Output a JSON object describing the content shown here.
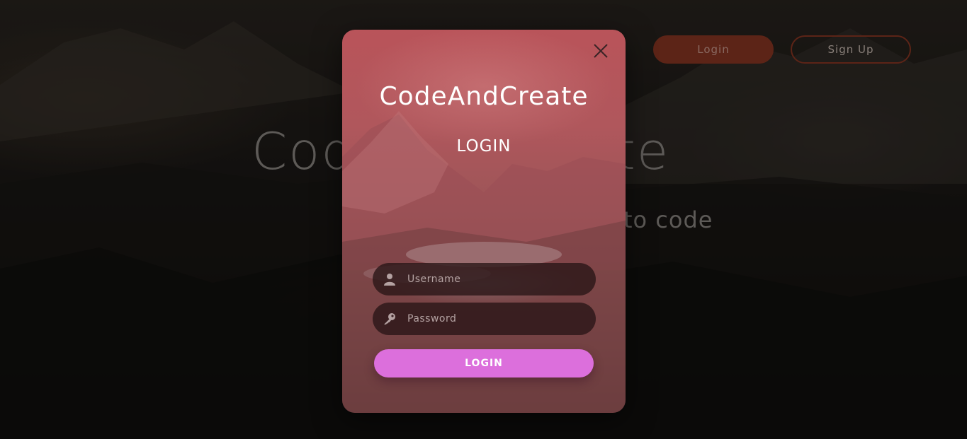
{
  "nav": {
    "login_label": "Login",
    "signup_label": "Sign Up"
  },
  "hero": {
    "title": "CodeAndCreate",
    "subtitle": "to code"
  },
  "modal": {
    "brand": "CodeAndCreate",
    "title": "LOGIN",
    "username_placeholder": "Username",
    "password_placeholder": "Password",
    "submit_label": "LOGIN",
    "close_icon": "close-icon",
    "username_icon": "user-icon",
    "password_icon": "key-icon"
  },
  "colors": {
    "accent": "#dc6fdc",
    "nav_accent": "#5c2417"
  }
}
